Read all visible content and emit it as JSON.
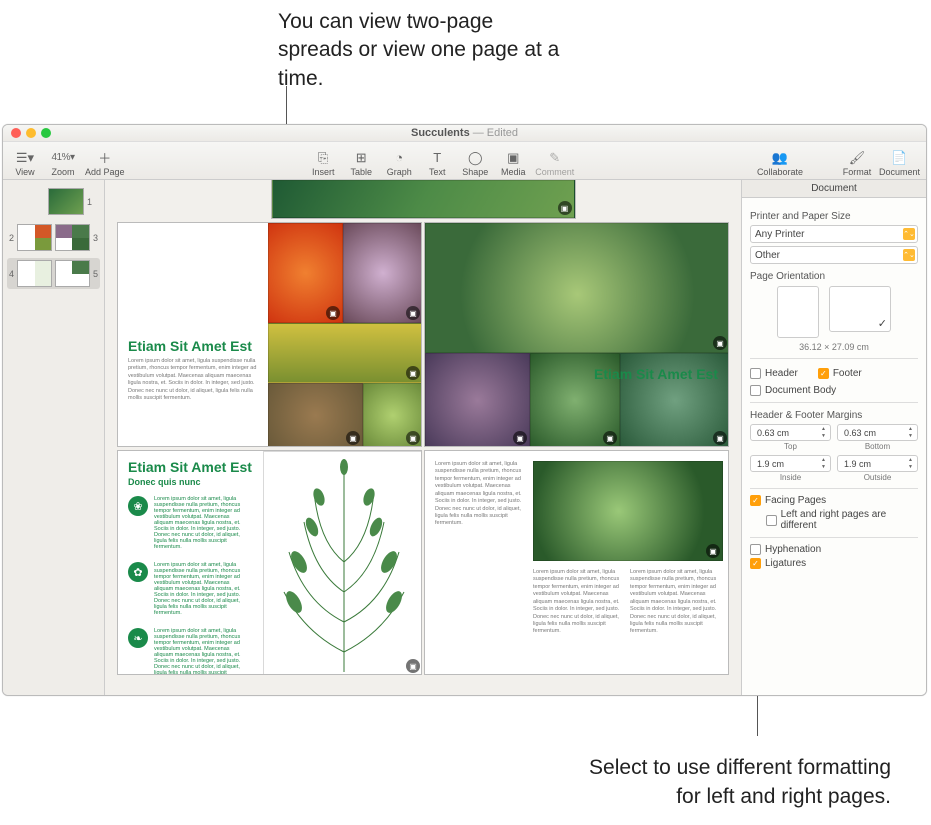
{
  "annotations": {
    "top": "You can view two-page spreads or view one page at a time.",
    "bottom": "Select to use different formatting for left and right pages."
  },
  "title": {
    "name": "Succulents",
    "status": "— Edited"
  },
  "toolbar": {
    "view": "View",
    "zoom": "Zoom",
    "zoom_val": "41%",
    "addpage": "Add Page",
    "insert": "Insert",
    "table": "Table",
    "graph": "Graph",
    "text": "Text",
    "shape": "Shape",
    "media": "Media",
    "comment": "Comment",
    "collaborate": "Collaborate",
    "format": "Format",
    "document": "Document"
  },
  "thumbs": {
    "p1": "1",
    "p2": "2",
    "p3": "3",
    "p4": "4",
    "p5": "5"
  },
  "pages": {
    "heading": "Etiam Sit Amet Est",
    "subhead": "Donec quis nunc",
    "body": "Lorem ipsum dolor sit amet, ligula suspendisse nulla pretium, rhoncus tempor fermentum, enim integer ad vestibulum volutpat. Maecenas aliquam maecenas ligula nostra, et. Sociis in dolor. In integer, sed justo. Donec nec nunc ut dolor, id aliquet, ligula felis nulla mollis suscipit fermentum."
  },
  "inspector": {
    "title": "Document",
    "printer_label": "Printer and Paper Size",
    "printer": "Any Printer",
    "paper": "Other",
    "orient_label": "Page Orientation",
    "dims": "36.12 × 27.09 cm",
    "header": "Header",
    "footer": "Footer",
    "docbody": "Document Body",
    "hf_label": "Header & Footer Margins",
    "top_val": "0.63 cm",
    "bot_val": "0.63 cm",
    "top": "Top",
    "bottom": "Bottom",
    "in_val": "1.9 cm",
    "out_val": "1.9 cm",
    "inside": "Inside",
    "outside": "Outside",
    "facing": "Facing Pages",
    "lr_diff": "Left and right pages are different",
    "hyphen": "Hyphenation",
    "lig": "Ligatures"
  }
}
